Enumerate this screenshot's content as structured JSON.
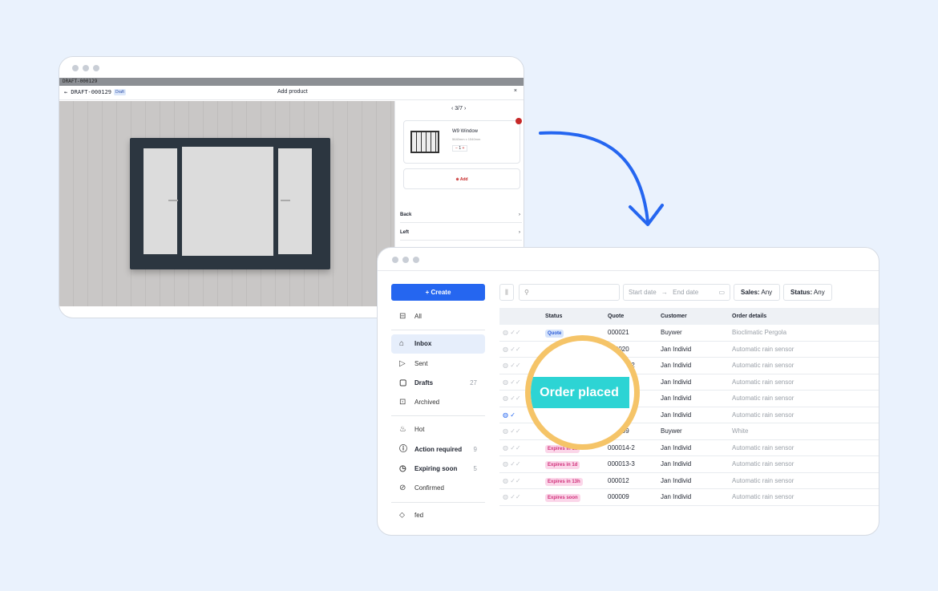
{
  "configurator": {
    "top_bar": "DRAFT-000129",
    "back_label": "← DRAFT-000129",
    "draft_badge": "Draft",
    "title": "Add product",
    "close": "×",
    "pager": "‹ 3/7 ›",
    "product_name": "W9 Window",
    "product_dims": "5640mm x 1540mm",
    "qty_minus": "−",
    "qty_value": "1",
    "qty_plus": "+",
    "add_label": "⊕ Add",
    "sections": [
      {
        "label": "Back"
      },
      {
        "label": "Left"
      }
    ],
    "chevron": "›"
  },
  "sidebar": {
    "create_label": "+ Create",
    "items": [
      {
        "label": "All",
        "icon": "inbox-stack-icon",
        "glyph": "⊟",
        "count": "",
        "bold": false
      },
      {
        "label": "Inbox",
        "icon": "inbox-icon",
        "glyph": "⌂",
        "count": "",
        "bold": true
      },
      {
        "label": "Sent",
        "icon": "send-icon",
        "glyph": "▷",
        "count": "",
        "bold": false
      },
      {
        "label": "Drafts",
        "icon": "file-icon",
        "glyph": "▢",
        "count": "27",
        "bold": true
      },
      {
        "label": "Archived",
        "icon": "archive-icon",
        "glyph": "⊡",
        "count": "",
        "bold": false
      },
      {
        "label": "Hot",
        "icon": "flame-icon",
        "glyph": "♨",
        "count": "",
        "bold": false
      },
      {
        "label": "Action required",
        "icon": "alert-icon",
        "glyph": "ⓘ",
        "count": "9",
        "bold": true
      },
      {
        "label": "Expiring soon",
        "icon": "clock-icon",
        "glyph": "◷",
        "count": "5",
        "bold": true
      },
      {
        "label": "Confirmed",
        "icon": "check-circle-icon",
        "glyph": "⊘",
        "count": "",
        "bold": false
      },
      {
        "label": "fed",
        "icon": "tag-icon",
        "glyph": "⬦",
        "count": "",
        "bold": false
      }
    ]
  },
  "toolbar": {
    "columns_icon": "⫼",
    "search_icon": "⚲",
    "start_date": "Start date",
    "arrow": "→",
    "end_date": "End date",
    "calendar_icon": "▭",
    "sales_key": "Sales:",
    "sales_value": "Any",
    "status_key": "Status:",
    "status_value": "Any"
  },
  "table": {
    "headers": {
      "status": "Status",
      "quote": "Quote",
      "customer": "Customer",
      "details": "Order details"
    },
    "rows": [
      {
        "status": "Quote",
        "kind": "quote",
        "quote": "000021",
        "customer": "Buywer",
        "details": "Bioclimatic Pergola",
        "checked": false
      },
      {
        "status": "",
        "kind": "",
        "quote": "000020",
        "customer": "Jan Individ",
        "details": "Automatic rain sensor",
        "checked": false
      },
      {
        "status": "",
        "kind": "",
        "quote": "000015-2",
        "customer": "Jan Individ",
        "details": "Automatic rain sensor",
        "checked": false
      },
      {
        "status": "",
        "kind": "",
        "quote": "000012-5",
        "customer": "Jan Individ",
        "details": "Automatic rain sensor",
        "checked": false
      },
      {
        "status": "",
        "kind": "",
        "quote": "000011-2",
        "customer": "Jan Individ",
        "details": "Automatic rain sensor",
        "checked": false
      },
      {
        "status": "",
        "kind": "",
        "quote": "000010-4",
        "customer": "Jan Individ",
        "details": "Automatic rain sensor",
        "checked": true
      },
      {
        "status": "",
        "kind": "green",
        "quote": "000009",
        "customer": "Buywer",
        "details": "White",
        "checked": false
      },
      {
        "status": "Expires in 1d",
        "kind": "exp",
        "quote": "000014-2",
        "customer": "Jan Individ",
        "details": "Automatic rain sensor",
        "checked": false
      },
      {
        "status": "Expires in 1d",
        "kind": "exp",
        "quote": "000013-3",
        "customer": "Jan Individ",
        "details": "Automatic rain sensor",
        "checked": false
      },
      {
        "status": "Expires in 13h",
        "kind": "exp",
        "quote": "000012",
        "customer": "Jan Individ",
        "details": "Automatic rain sensor",
        "checked": false
      },
      {
        "status": "Expires soon",
        "kind": "exp",
        "quote": "000009",
        "customer": "Jan Individ",
        "details": "Automatic rain sensor",
        "checked": false
      }
    ]
  },
  "highlight": {
    "label": "Order placed"
  },
  "colors": {
    "accent": "#2566f0",
    "highlight": "#2dd4d4",
    "ring": "#f5c468"
  }
}
